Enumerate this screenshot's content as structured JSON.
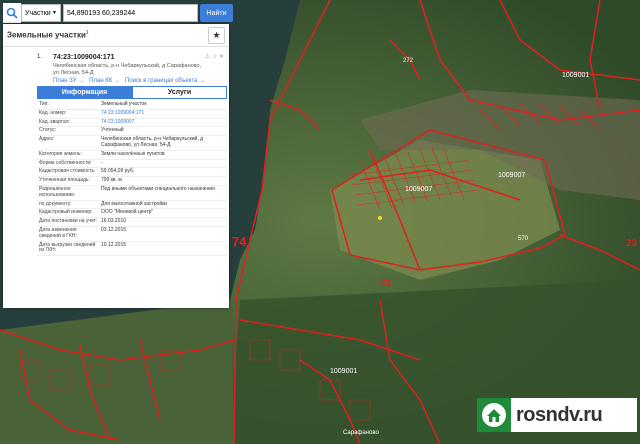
{
  "search": {
    "dropdown_label": "Участки",
    "query": "54,890193 60,239244",
    "find_label": "Найти"
  },
  "panel": {
    "title": "Земельные участки",
    "count": "1",
    "result": {
      "number": "1.",
      "cadastral": "74:23:1009004:171",
      "address": "Челябинская область, р-н Чебаркульский, д Сарафаново, ул Лесная, 54-Д",
      "links": [
        "План ЗУ →",
        "План КК →",
        "Поиск в границах объекта →"
      ]
    },
    "tabs": [
      "Информация",
      "Услуги"
    ],
    "rows": [
      {
        "k": "Тип:",
        "v": "Земельный участок"
      },
      {
        "k": "Кад. номер:",
        "v": "74:23:1009004:171",
        "link": true
      },
      {
        "k": "Кад. квартал:",
        "v": "74:23:1009007",
        "link": true
      },
      {
        "k": "Статус:",
        "v": "Учтенный"
      },
      {
        "k": "Адрес:",
        "v": "Челябинская область, р-н Чебаркульский, д Сарафаново, ул Лесная, 54-Д"
      },
      {
        "k": "Категория земель:",
        "v": "Земли населённых пунктов"
      },
      {
        "k": "Форма собственности:",
        "v": "-"
      },
      {
        "k": "Кадастровая стоимость:",
        "v": "59 054,09 руб."
      },
      {
        "k": "Уточненная площадь:",
        "v": "799 кв. м"
      },
      {
        "k": "Разрешенное использование:",
        "v": "Под иными объектами специального назначения"
      },
      {
        "k": "по документу:",
        "v": "Для малоэтажной застройки"
      },
      {
        "k": "Кадастровый инженер:",
        "v": "ООО \"Меневой центр\""
      },
      {
        "k": "Дата постановки на учет:",
        "v": "16.03.2010"
      },
      {
        "k": "Дата изменения сведений в ГКН:",
        "v": "03.12.2015"
      },
      {
        "k": "Дата выгрузки сведений из ГКН:",
        "v": "10.12.2015"
      }
    ]
  },
  "map": {
    "labels": [
      "1009001",
      "1009007",
      "1009007",
      "1009001",
      "23",
      "23",
      "74",
      "570",
      "272",
      "Сарафаново"
    ]
  },
  "logo": {
    "text": "rosndv.ru"
  },
  "colors": {
    "accent": "#3b7dd8",
    "parcel": "#e02020",
    "logo_green": "#1f8a3a"
  }
}
